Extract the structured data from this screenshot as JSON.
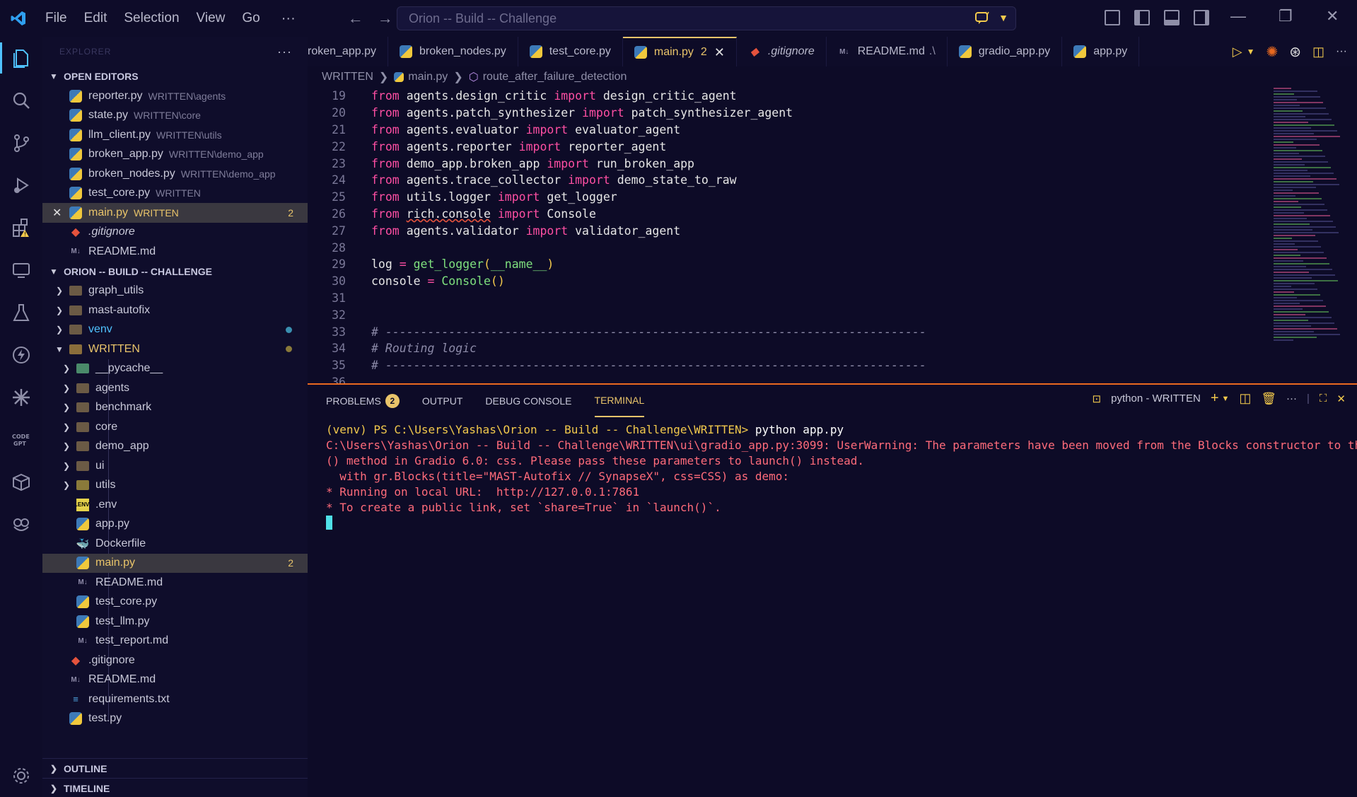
{
  "titlebar": {
    "menu": [
      "File",
      "Edit",
      "Selection",
      "View",
      "Go"
    ],
    "more": "···",
    "search_text": "Orion -- Build -- Challenge"
  },
  "sidebar": {
    "header": "EXPLORER",
    "open_editors": {
      "title": "OPEN EDITORS",
      "items": [
        {
          "name": "reporter.py",
          "desc": "WRITTEN\\agents"
        },
        {
          "name": "state.py",
          "desc": "WRITTEN\\core"
        },
        {
          "name": "llm_client.py",
          "desc": "WRITTEN\\utils"
        },
        {
          "name": "broken_app.py",
          "desc": "WRITTEN\\demo_app"
        },
        {
          "name": "broken_nodes.py",
          "desc": "WRITTEN\\demo_app"
        },
        {
          "name": "test_core.py",
          "desc": "WRITTEN"
        },
        {
          "name": "main.py",
          "desc": "WRITTEN",
          "badge": "2"
        },
        {
          "name": ".gitignore",
          "desc": ""
        },
        {
          "name": "README.md",
          "desc": ""
        }
      ]
    },
    "workspace": {
      "title": "ORION -- BUILD -- CHALLENGE",
      "items": [
        {
          "name": "graph_utils",
          "type": "folder"
        },
        {
          "name": "mast-autofix",
          "type": "folder"
        },
        {
          "name": "venv",
          "type": "folder"
        },
        {
          "name": "WRITTEN",
          "type": "folder-open"
        },
        {
          "name": "__pycache__",
          "type": "folder"
        },
        {
          "name": "agents",
          "type": "folder"
        },
        {
          "name": "benchmark",
          "type": "folder"
        },
        {
          "name": "core",
          "type": "folder"
        },
        {
          "name": "demo_app",
          "type": "folder"
        },
        {
          "name": "ui",
          "type": "folder"
        },
        {
          "name": "utils",
          "type": "folder"
        },
        {
          "name": ".env",
          "type": "env"
        },
        {
          "name": "app.py",
          "type": "py"
        },
        {
          "name": "Dockerfile",
          "type": "docker"
        },
        {
          "name": "main.py",
          "type": "py",
          "badge": "2"
        },
        {
          "name": "README.md",
          "type": "md"
        },
        {
          "name": "test_core.py",
          "type": "py"
        },
        {
          "name": "test_llm.py",
          "type": "py"
        },
        {
          "name": "test_report.md",
          "type": "md"
        },
        {
          "name": ".gitignore",
          "type": "git"
        },
        {
          "name": "README.md",
          "type": "md"
        },
        {
          "name": "requirements.txt",
          "type": "txt"
        },
        {
          "name": "test.py",
          "type": "py"
        }
      ]
    },
    "outline": "OUTLINE",
    "timeline": "TIMELINE"
  },
  "tabs": [
    {
      "label": "roken_app.py"
    },
    {
      "label": "broken_nodes.py"
    },
    {
      "label": "test_core.py"
    },
    {
      "label": "main.py",
      "badge": "2",
      "active": true
    },
    {
      "label": ".gitignore"
    },
    {
      "label": "README.md",
      "suffix": ".\\"
    },
    {
      "label": "gradio_app.py"
    },
    {
      "label": "app.py"
    }
  ],
  "breadcrumb": {
    "folder": "WRITTEN",
    "file": "main.py",
    "symbol": "route_after_failure_detection"
  },
  "editor": {
    "lines": [
      {
        "n": "19",
        "mod": "agents.design_critic",
        "name": "design_critic_agent"
      },
      {
        "n": "20",
        "mod": "agents.patch_synthesizer",
        "name": "patch_synthesizer_agent"
      },
      {
        "n": "21",
        "mod": "agents.evaluator",
        "name": "evaluator_agent"
      },
      {
        "n": "22",
        "mod": "agents.reporter",
        "name": "reporter_agent"
      },
      {
        "n": "23",
        "mod": "demo_app.broken_app",
        "name": "run_broken_app"
      },
      {
        "n": "24",
        "mod": "agents.trace_collector",
        "name": "demo_state_to_raw"
      },
      {
        "n": "25",
        "mod": "utils.logger",
        "name": "get_logger"
      },
      {
        "n": "26",
        "mod": "rich.console",
        "name": "Console"
      },
      {
        "n": "27",
        "mod": "agents.validator",
        "name": "validator_agent"
      }
    ],
    "kw_from": "from",
    "kw_import": "import",
    "line28": "28",
    "line29": {
      "n": "29",
      "var": "log",
      "fn": "get_logger",
      "arg": "__name__"
    },
    "line30": {
      "n": "30",
      "var": "console",
      "fn": "Console"
    },
    "line31": "31",
    "line32": "32",
    "line33": {
      "n": "33",
      "text": "# -----------------------------------------------------------------------------"
    },
    "line34": {
      "n": "34",
      "text": "# Routing logic"
    },
    "line35": {
      "n": "35",
      "text": "# -----------------------------------------------------------------------------"
    },
    "line36": "36"
  },
  "panel": {
    "tabs": [
      "PROBLEMS",
      "OUTPUT",
      "DEBUG CONSOLE",
      "TERMINAL"
    ],
    "problems_count": "2",
    "terminal_name": "python - WRITTEN",
    "terminal": {
      "prompt": "(venv) PS C:\\Users\\Yashas\\Orion -- Build -- Challenge\\WRITTEN>",
      "command": "python app.py",
      "out1": "C:\\Users\\Yashas\\Orion -- Build -- Challenge\\WRITTEN\\ui\\gradio_app.py:3099: UserWarning: The parameters have been moved from the Blocks constructor to the launch",
      "out2": "() method in Gradio 6.0: css. Please pass these parameters to launch() instead.",
      "out3": "  with gr.Blocks(title=\"MAST-Autofix // SynapseX\", css=CSS) as demo:",
      "out4": "* Running on local URL:  http://127.0.0.1:7861",
      "out5": "* To create a public link, set `share=True` in `launch()`."
    }
  },
  "colors": {
    "accent": "#e9c46a",
    "keyword": "#ff4fa3",
    "function": "#7ee07e",
    "panel_border": "#e9691f",
    "background": "#0d0b27"
  }
}
